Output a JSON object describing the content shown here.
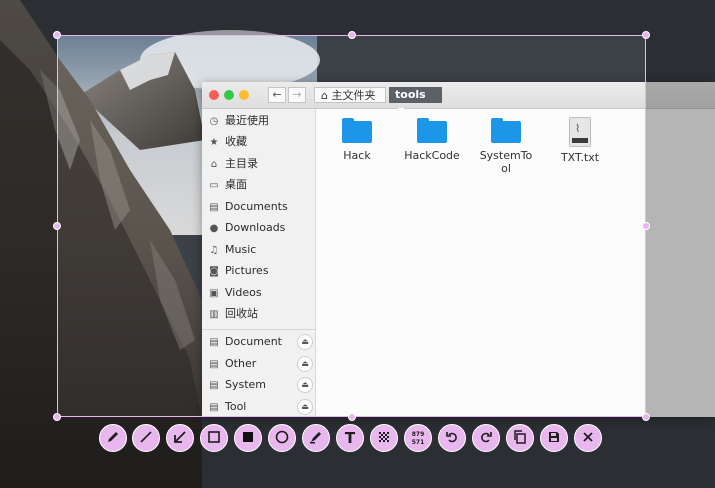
{
  "colors": {
    "accent": "#e8b7ee",
    "folder": "#1c97e8",
    "crumb_active": "#5c6168"
  },
  "window": {
    "breadcrumb": {
      "home_label": "主文件夹",
      "current_label": "tools"
    }
  },
  "sidebar": {
    "places": [
      {
        "label": "最近使用",
        "icon": "clock-icon"
      },
      {
        "label": "收藏",
        "icon": "star-icon"
      },
      {
        "label": "主目录",
        "icon": "home-icon"
      },
      {
        "label": "桌面",
        "icon": "desktop-icon"
      },
      {
        "label": "Documents",
        "icon": "document-icon"
      },
      {
        "label": "Downloads",
        "icon": "download-icon"
      },
      {
        "label": "Music",
        "icon": "music-icon"
      },
      {
        "label": "Pictures",
        "icon": "camera-icon"
      },
      {
        "label": "Videos",
        "icon": "film-icon"
      },
      {
        "label": "回收站",
        "icon": "trash-icon"
      }
    ],
    "devices": [
      {
        "label": "Document",
        "icon": "drive-icon"
      },
      {
        "label": "Other",
        "icon": "drive-icon"
      },
      {
        "label": "System",
        "icon": "drive-icon"
      },
      {
        "label": "Tool",
        "icon": "drive-icon"
      }
    ]
  },
  "files": [
    {
      "name": "Hack",
      "type": "folder"
    },
    {
      "name": "HackCode",
      "type": "folder"
    },
    {
      "name": "SystemTo",
      "name2": "ol",
      "type": "folder"
    },
    {
      "name": "TXT.txt",
      "type": "text"
    }
  ],
  "toolbar": {
    "size_readout_w": "879",
    "size_readout_h": "571",
    "tools": [
      "pencil-icon",
      "line-icon",
      "arrow-icon",
      "rectangle-icon",
      "filled-rectangle-icon",
      "circle-icon",
      "marker-icon",
      "text-icon",
      "pixelate-icon",
      "size-readout",
      "undo-icon",
      "redo-icon",
      "copy-icon",
      "save-icon",
      "close-icon"
    ]
  }
}
